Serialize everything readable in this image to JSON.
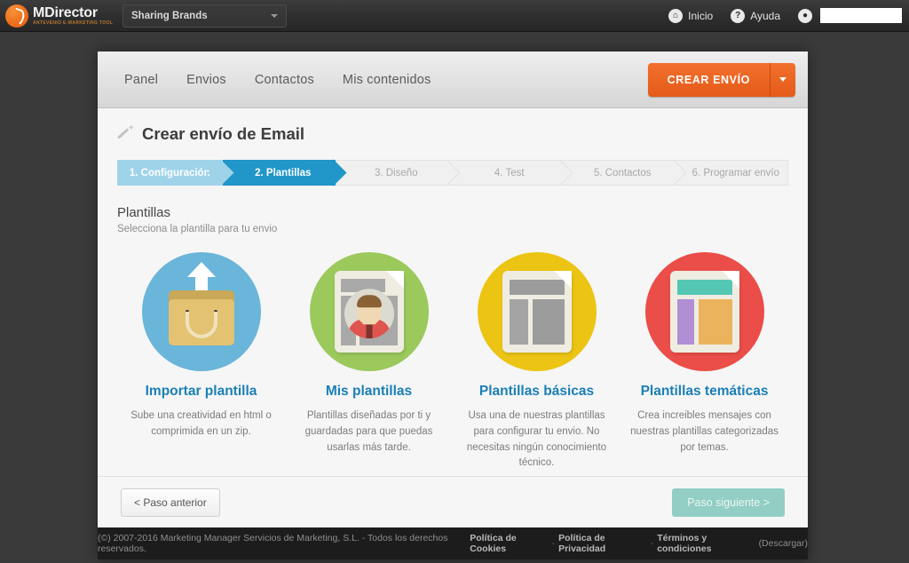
{
  "topbar": {
    "brand_name": "MDirector",
    "brand_tagline": "ANTEVENIO E-MARKETING TOOL",
    "account_select": "Sharing Brands",
    "home_label": "Inicio",
    "help_label": "Ayuda",
    "home_icon": "home-icon",
    "help_icon": "question-icon",
    "user_icon": "user-icon",
    "user_name": ""
  },
  "appnav": {
    "items": [
      {
        "label": "Panel"
      },
      {
        "label": "Envios"
      },
      {
        "label": "Contactos"
      },
      {
        "label": "Mis contenidos"
      }
    ],
    "cta_label": "CREAR ENVÍO"
  },
  "page": {
    "title": "Crear envío de Email",
    "title_icon": "magic-wand-icon"
  },
  "steps": [
    {
      "label": "1. Configuración",
      "state": "done"
    },
    {
      "label": "2. Plantillas",
      "state": "active"
    },
    {
      "label": "3. Diseño",
      "state": "pending"
    },
    {
      "label": "4. Test",
      "state": "pending"
    },
    {
      "label": "5. Contactos",
      "state": "pending"
    },
    {
      "label": "6. Programar envío",
      "state": "pending"
    }
  ],
  "section": {
    "title": "Plantillas",
    "subtitle": "Selecciona la plantilla para tu envio"
  },
  "cards": [
    {
      "title": "Importar plantilla",
      "desc": "Sube una creatividad en html o comprimida en un zip.",
      "icon": "import-bag-upload-icon",
      "color": "#6ab5da"
    },
    {
      "title": "Mis plantillas",
      "desc": "Plantillas diseñadas por ti y guardadas para que puedas usarlas más tarde.",
      "icon": "document-avatar-icon",
      "color": "#9bc košt"
    },
    {
      "title": "Plantillas básicas",
      "desc": "Usa una de nuestras plantillas para configurar tu envio. No necesitas ningún conocimiento técnico.",
      "icon": "document-gray-layout-icon",
      "color": "#ecc413"
    },
    {
      "title": "Plantillas temáticas",
      "desc": "Crea increibles mensajes con nuestras plantillas categorizadas por temas.",
      "icon": "document-color-layout-icon",
      "color": "#eb4d48"
    }
  ],
  "card_colors": [
    "#6ab5da",
    "#9bc95c",
    "#ecc413",
    "#eb4d48"
  ],
  "footer_buttons": {
    "prev": "< Paso anterior",
    "next": "Paso siguiente >"
  },
  "site_footer": {
    "copyright": "(©) 2007-2016 Marketing Manager Servicios de Marketing, S.L. - Todos los derechos reservados.",
    "link_cookies": "Política de Cookies",
    "sep1": "-",
    "link_privacy": "Política de Privacidad",
    "sep2": "-",
    "link_terms": "Términos y condiciones",
    "download": "(Descargar)"
  }
}
